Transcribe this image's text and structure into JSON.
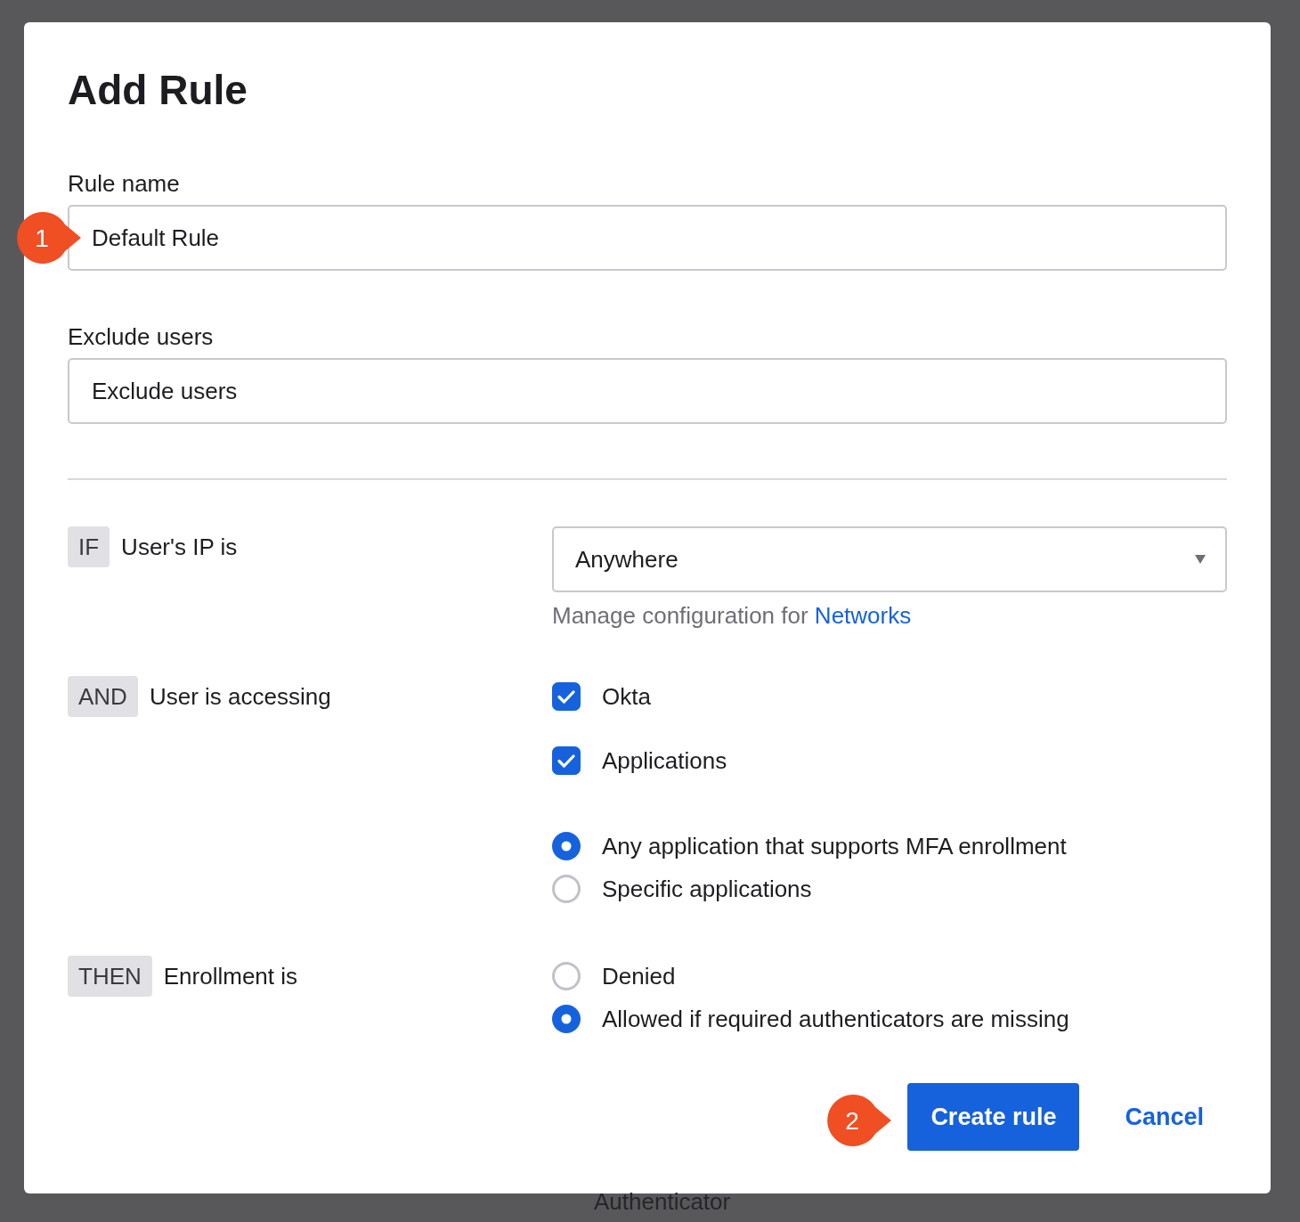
{
  "dialog": {
    "title": "Add Rule",
    "fields": [
      {
        "label": "Rule name",
        "value": "Default Rule",
        "callout": "1"
      },
      {
        "label": "Exclude users",
        "placeholder": "Exclude users"
      }
    ],
    "conditions": [
      {
        "keyword": "IF",
        "label": "User's IP is",
        "controls": [
          {
            "kind": "select",
            "value": "Anywhere"
          },
          {
            "kind": "help",
            "text": "Manage configuration for",
            "link": "Networks"
          }
        ]
      },
      {
        "keyword": "AND",
        "label": "User is accessing",
        "controls": [
          {
            "kind": "checkbox",
            "label": "Okta",
            "checked": true
          },
          {
            "kind": "checkbox",
            "label": "Applications",
            "checked": true
          },
          {
            "kind": "radios",
            "options": [
              {
                "label": "Any application that supports MFA enrollment",
                "selected": true
              },
              {
                "label": "Specific applications",
                "selected": false
              }
            ]
          }
        ]
      },
      {
        "keyword": "THEN",
        "label": "Enrollment is",
        "controls": [
          {
            "kind": "radios",
            "options": [
              {
                "label": "Denied",
                "selected": false
              },
              {
                "label": "Allowed if required authenticators are missing",
                "selected": true
              }
            ]
          }
        ]
      }
    ],
    "actions": [
      {
        "kind": "primary",
        "label": "Create rule",
        "callout": "2"
      },
      {
        "kind": "link",
        "label": "Cancel"
      }
    ]
  },
  "background": {
    "text": "Authenticator"
  }
}
